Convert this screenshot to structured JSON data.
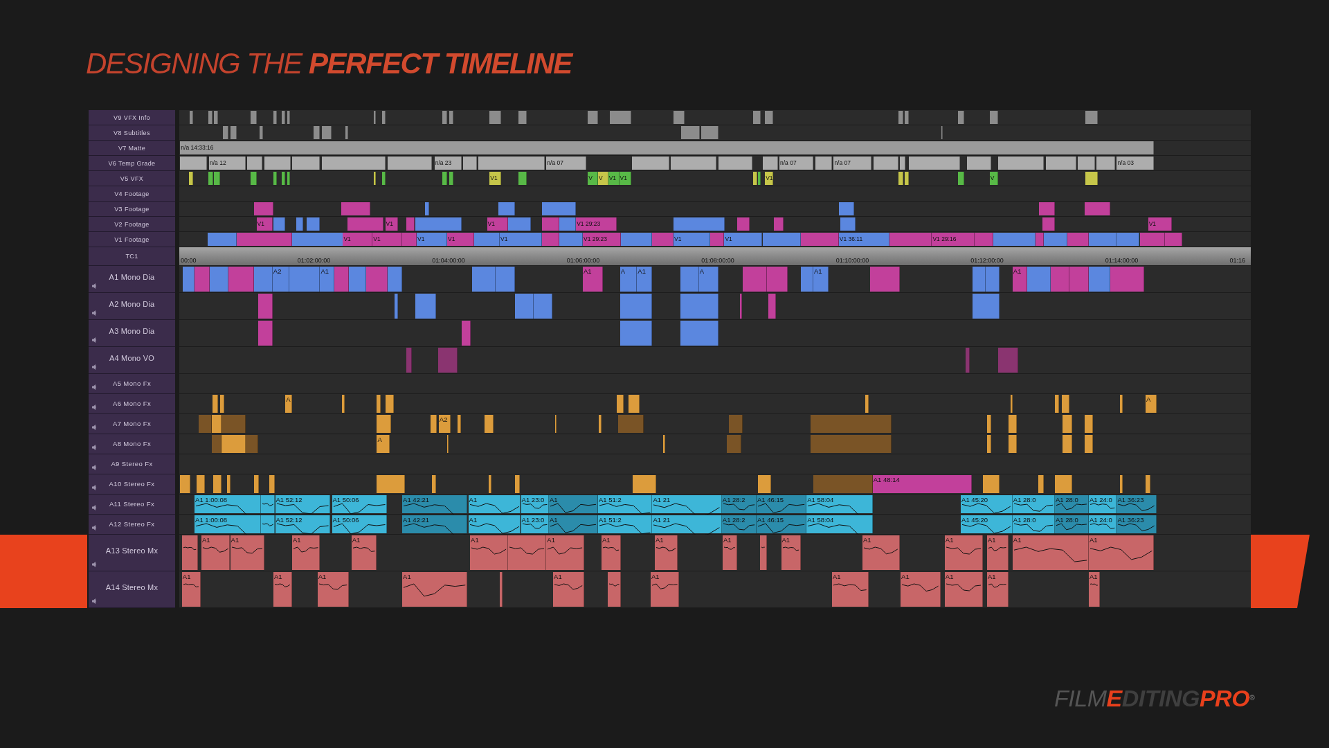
{
  "title": "DESIGNING THE **PERFECT TIMELINE**",
  "tracks": [
    {
      "name": "V9 VFX Info",
      "kind": "video",
      "clips": [
        {
          "color": "#8c8c8c"
        },
        {
          "color": "#8c8c8c"
        },
        {
          "color": "#8c8c8c"
        },
        {
          "color": "#8c8c8c"
        },
        {
          "color": "#8c8c8c"
        },
        {
          "color": "#8c8c8c"
        },
        {
          "color": "#8c8c8c"
        },
        {
          "color": "#8c8c8c"
        },
        {
          "color": "#8c8c8c"
        },
        {
          "color": "#8c8c8c"
        },
        {
          "color": "#8c8c8c"
        },
        {
          "color": "#8c8c8c"
        },
        {
          "color": "#8c8c8c"
        },
        {
          "color": "#8c8c8c"
        },
        {
          "color": "#8c8c8c"
        },
        {
          "color": "#8c8c8c"
        },
        {
          "color": "#8c8c8c"
        },
        {
          "color": "#8c8c8c"
        },
        {
          "color": "#8c8c8c"
        },
        {
          "color": "#8c8c8c"
        },
        {
          "color": "#8c8c8c"
        },
        {
          "color": "#8c8c8c"
        },
        {
          "color": "#8c8c8c"
        }
      ]
    },
    {
      "name": "V8 Subtitles",
      "kind": "video",
      "clips": [
        {
          "color": "#8c8c8c"
        },
        {
          "color": "#8c8c8c"
        },
        {
          "color": "#8c8c8c"
        },
        {
          "color": "#8c8c8c"
        },
        {
          "color": "#8c8c8c"
        },
        {
          "color": "#8c8c8c"
        },
        {
          "color": "#8c8c8c"
        },
        {
          "color": "#8c8c8c"
        },
        {
          "color": "#8c8c8c"
        }
      ]
    },
    {
      "name": "V7 Matte",
      "kind": "video",
      "clips": [
        {
          "color": "#9b9b9b",
          "label": "n/a 14:33:16"
        }
      ]
    },
    {
      "name": "V6 Temp Grade",
      "kind": "video",
      "clips": [
        {
          "color": "#adadad"
        },
        {
          "color": "#adadad",
          "label": "n/a 12"
        },
        {
          "color": "#adadad"
        },
        {
          "color": "#adadad"
        },
        {
          "color": "#adadad"
        },
        {
          "color": "#adadad"
        },
        {
          "color": "#adadad"
        },
        {
          "color": "#adadad",
          "label": "n/a 23"
        },
        {
          "color": "#adadad"
        },
        {
          "color": "#adadad"
        },
        {
          "color": "#adadad",
          "label": "n/a 07"
        },
        {
          "color": "#adadad"
        },
        {
          "color": "#adadad"
        },
        {
          "color": "#adadad"
        },
        {
          "color": "#adadad"
        },
        {
          "color": "#adadad",
          "label": "n/a 07"
        },
        {
          "color": "#adadad"
        },
        {
          "color": "#adadad",
          "label": "n/a 07"
        },
        {
          "color": "#adadad"
        },
        {
          "color": "#adadad"
        },
        {
          "color": "#adadad"
        },
        {
          "color": "#adadad"
        },
        {
          "color": "#adadad"
        },
        {
          "color": "#adadad"
        },
        {
          "color": "#adadad"
        },
        {
          "color": "#adadad"
        },
        {
          "color": "#adadad",
          "label": "n/a 03"
        }
      ]
    },
    {
      "name": "V5 VFX",
      "kind": "video",
      "clips": [
        {
          "color": "#c6c64a"
        },
        {
          "color": "#58b947"
        },
        {
          "color": "#58b947"
        },
        {
          "color": "#58b947"
        },
        {
          "color": "#58b947"
        },
        {
          "color": "#58b947"
        },
        {
          "color": "#58b947"
        },
        {
          "color": "#c6c64a"
        },
        {
          "color": "#58b947"
        },
        {
          "color": "#58b947"
        },
        {
          "color": "#58b947"
        },
        {
          "color": "#c6c64a",
          "label": "V1"
        },
        {
          "color": "#58b947"
        },
        {
          "color": "#58b947",
          "label": "V"
        },
        {
          "color": "#c6c64a",
          "label": "V"
        },
        {
          "color": "#58b947",
          "label": "V1"
        },
        {
          "color": "#58b947",
          "label": "V1"
        },
        {
          "color": "#c6c64a"
        },
        {
          "color": "#58b947"
        },
        {
          "color": "#c6c64a",
          "label": "V1"
        },
        {
          "color": "#c6c64a"
        },
        {
          "color": "#c6c64a"
        },
        {
          "color": "#58b947"
        },
        {
          "color": "#58b947",
          "label": "V"
        },
        {
          "color": "#c6c64a"
        }
      ]
    },
    {
      "name": "V4 Footage",
      "kind": "video"
    },
    {
      "name": "V3 Footage",
      "kind": "video",
      "clips": [
        {
          "color": "#c2409b"
        },
        {
          "color": "#c2409b"
        },
        {
          "color": "#5b87df"
        },
        {
          "color": "#5b87df"
        },
        {
          "color": "#5b87df"
        },
        {
          "color": "#5b87df"
        },
        {
          "color": "#c2409b"
        },
        {
          "color": "#c2409b"
        }
      ]
    },
    {
      "name": "V2 Footage",
      "kind": "video",
      "clips": [
        {
          "color": "#c2409b",
          "label": "V1"
        },
        {
          "color": "#5b87df"
        },
        {
          "color": "#5b87df"
        },
        {
          "color": "#5b87df"
        },
        {
          "color": "#c2409b"
        },
        {
          "color": "#c2409b",
          "label": "V1"
        },
        {
          "color": "#c2409b"
        },
        {
          "color": "#5b87df"
        },
        {
          "color": "#c2409b",
          "label": "V1"
        },
        {
          "color": "#5b87df"
        },
        {
          "color": "#c2409b"
        },
        {
          "color": "#5b87df"
        },
        {
          "color": "#c2409b",
          "label": "V1 29:23"
        },
        {
          "color": "#5b87df"
        },
        {
          "color": "#c2409b"
        },
        {
          "color": "#c2409b"
        },
        {
          "color": "#5b87df"
        },
        {
          "color": "#c2409b"
        },
        {
          "color": "#c2409b",
          "label": "V1"
        }
      ]
    },
    {
      "name": "V1 Footage",
      "kind": "video",
      "clips": [
        {
          "color": "#5b87df"
        },
        {
          "color": "#c2409b"
        },
        {
          "color": "#5b87df"
        },
        {
          "color": "#c2409b",
          "label": "V1"
        },
        {
          "color": "#c2409b",
          "label": "V1"
        },
        {
          "color": "#c2409b"
        },
        {
          "color": "#5b87df",
          "label": "V1"
        },
        {
          "color": "#c2409b",
          "label": "V1"
        },
        {
          "color": "#5b87df"
        },
        {
          "color": "#5b87df",
          "label": "V1"
        },
        {
          "color": "#c2409b"
        },
        {
          "color": "#5b87df"
        },
        {
          "color": "#c2409b",
          "label": "V1 29:23"
        },
        {
          "color": "#5b87df"
        },
        {
          "color": "#c2409b"
        },
        {
          "color": "#5b87df",
          "label": "V1"
        },
        {
          "color": "#c2409b"
        },
        {
          "color": "#5b87df",
          "label": "V1"
        },
        {
          "color": "#5b87df"
        },
        {
          "color": "#c2409b"
        },
        {
          "color": "#5b87df",
          "label": "V1 36:11"
        },
        {
          "color": "#c2409b"
        },
        {
          "color": "#c2409b",
          "label": "V1 29:16"
        },
        {
          "color": "#c2409b"
        },
        {
          "color": "#5b87df"
        },
        {
          "color": "#c2409b"
        },
        {
          "color": "#5b87df"
        },
        {
          "color": "#c2409b"
        },
        {
          "color": "#5b87df"
        },
        {
          "color": "#5b87df"
        },
        {
          "color": "#c2409b"
        },
        {
          "color": "#c2409b"
        }
      ]
    },
    {
      "name": "TC1",
      "kind": "timecode",
      "marks": [
        "00:00",
        "01:02:00:00",
        "01:04:00:00",
        "01:06:00:00",
        "01:08:00:00",
        "01:10:00:00",
        "01:12:00:00",
        "01:14:00:00",
        "01:16"
      ]
    },
    {
      "name": "A1 Mono Dia",
      "kind": "audio",
      "volume_lines": false,
      "clips": [
        {
          "color": "#5b87df"
        },
        {
          "color": "#c2409b"
        },
        {
          "color": "#5b87df"
        },
        {
          "color": "#c2409b"
        },
        {
          "color": "#5b87df"
        },
        {
          "color": "#5b87df",
          "label": "A2"
        },
        {
          "color": "#5b87df"
        },
        {
          "color": "#5b87df",
          "label": "A1"
        },
        {
          "color": "#c2409b"
        },
        {
          "color": "#5b87df"
        },
        {
          "color": "#c2409b"
        },
        {
          "color": "#5b87df"
        },
        {
          "color": "#5b87df"
        },
        {
          "color": "#5b87df"
        },
        {
          "color": "#c2409b",
          "label": "A1"
        },
        {
          "color": "#5b87df",
          "label": "A"
        },
        {
          "color": "#5b87df",
          "label": "A1"
        },
        {
          "color": "#5b87df"
        },
        {
          "color": "#5b87df",
          "label": "A"
        },
        {
          "color": "#c2409b"
        },
        {
          "color": "#c2409b"
        },
        {
          "color": "#5b87df"
        },
        {
          "color": "#5b87df",
          "label": "A1"
        },
        {
          "color": "#c2409b"
        },
        {
          "color": "#5b87df"
        },
        {
          "color": "#5b87df"
        },
        {
          "color": "#c2409b",
          "label": "A1"
        },
        {
          "color": "#5b87df"
        },
        {
          "color": "#c2409b"
        },
        {
          "color": "#c2409b"
        },
        {
          "color": "#5b87df"
        },
        {
          "color": "#c2409b"
        }
      ]
    },
    {
      "name": "A2 Mono Dia",
      "kind": "audio",
      "volume_lines": false,
      "clips": [
        {
          "color": "#c2409b"
        },
        {
          "color": "#5b87df"
        },
        {
          "color": "#5b87df"
        },
        {
          "color": "#5b87df"
        },
        {
          "color": "#5b87df"
        },
        {
          "color": "#5b87df"
        },
        {
          "color": "#5b87df"
        },
        {
          "color": "#c2409b"
        },
        {
          "color": "#c2409b"
        },
        {
          "color": "#5b87df"
        }
      ]
    },
    {
      "name": "A3 Mono Dia",
      "kind": "audio",
      "volume_lines": false,
      "clips": [
        {
          "color": "#c2409b"
        },
        {
          "color": "#c2409b"
        },
        {
          "color": "#5b87df"
        },
        {
          "color": "#5b87df"
        }
      ]
    },
    {
      "name": "A4 Mono VO",
      "kind": "audio",
      "volume_lines": false,
      "clips": [
        {
          "color": "#8a3470"
        },
        {
          "color": "#8a3470"
        },
        {
          "color": "#8a3470"
        },
        {
          "color": "#8a3470"
        }
      ]
    },
    {
      "name": "A5 Mono Fx",
      "kind": "audio"
    },
    {
      "name": "A6 Mono Fx",
      "kind": "audio",
      "volume_lines": false,
      "clips": [
        {
          "color": "#dc9c3c"
        },
        {
          "color": "#dc9c3c"
        },
        {
          "color": "#dc9c3c",
          "label": "A"
        },
        {
          "color": "#dc9c3c"
        },
        {
          "color": "#dc9c3c"
        },
        {
          "color": "#dc9c3c"
        },
        {
          "color": "#dc9c3c"
        },
        {
          "color": "#dc9c3c"
        },
        {
          "color": "#dc9c3c"
        },
        {
          "color": "#dc9c3c"
        },
        {
          "color": "#dc9c3c"
        },
        {
          "color": "#dc9c3c"
        },
        {
          "color": "#dc9c3c"
        },
        {
          "color": "#dc9c3c",
          "label": "A"
        }
      ]
    },
    {
      "name": "A7 Mono Fx",
      "kind": "audio",
      "volume_lines": false,
      "clips": [
        {
          "color": "#7a5426"
        },
        {
          "color": "#dc9c3c"
        },
        {
          "color": "#7a5426"
        },
        {
          "color": "#dc9c3c"
        },
        {
          "color": "#dc9c3c"
        },
        {
          "color": "#dc9c3c",
          "label": "A2"
        },
        {
          "color": "#dc9c3c"
        },
        {
          "color": "#dc9c3c"
        },
        {
          "color": "#dc9c3c"
        },
        {
          "color": "#dc9c3c"
        },
        {
          "color": "#7a5426"
        },
        {
          "color": "#7a5426"
        },
        {
          "color": "#7a5426"
        },
        {
          "color": "#dc9c3c"
        },
        {
          "color": "#dc9c3c"
        },
        {
          "color": "#dc9c3c"
        },
        {
          "color": "#dc9c3c"
        }
      ]
    },
    {
      "name": "A8 Mono Fx",
      "kind": "audio",
      "volume_lines": false,
      "clips": [
        {
          "color": "#7a5426"
        },
        {
          "color": "#dc9c3c"
        },
        {
          "color": "#7a5426"
        },
        {
          "color": "#dc9c3c",
          "label": "A"
        },
        {
          "color": "#dc9c3c"
        },
        {
          "color": "#dc9c3c"
        },
        {
          "color": "#7a5426"
        },
        {
          "color": "#7a5426"
        },
        {
          "color": "#dc9c3c"
        },
        {
          "color": "#dc9c3c"
        },
        {
          "color": "#dc9c3c"
        },
        {
          "color": "#dc9c3c"
        }
      ]
    },
    {
      "name": "A9 Stereo Fx",
      "kind": "audio"
    },
    {
      "name": "A10 Stereo Fx",
      "kind": "audio",
      "volume_lines": false,
      "clips": [
        {
          "color": "#dc9c3c"
        },
        {
          "color": "#dc9c3c"
        },
        {
          "color": "#dc9c3c"
        },
        {
          "color": "#dc9c3c"
        },
        {
          "color": "#dc9c3c"
        },
        {
          "color": "#dc9c3c"
        },
        {
          "color": "#dc9c3c"
        },
        {
          "color": "#dc9c3c"
        },
        {
          "color": "#dc9c3c"
        },
        {
          "color": "#dc9c3c"
        },
        {
          "color": "#dc9c3c"
        },
        {
          "color": "#dc9c3c"
        },
        {
          "color": "#7a5426"
        },
        {
          "color": "#c2409b",
          "label": "A1 48:14"
        },
        {
          "color": "#dc9c3c"
        },
        {
          "color": "#dc9c3c"
        },
        {
          "color": "#dc9c3c"
        },
        {
          "color": "#dc9c3c"
        },
        {
          "color": "#dc9c3c"
        }
      ]
    },
    {
      "name": "A11 Stereo Fx",
      "kind": "audio",
      "volume_lines": true,
      "clips": [
        {
          "color": "#3db6d8",
          "label": "A1 1:00:08"
        },
        {
          "color": "#3db6d8"
        },
        {
          "color": "#3db6d8",
          "label": "A1 52:12"
        },
        {
          "color": "#3db6d8",
          "label": "A1 50:06"
        },
        {
          "color": "#2b8cab",
          "label": "A1 42:21"
        },
        {
          "color": "#3db6d8",
          "label": "A1"
        },
        {
          "color": "#3db6d8",
          "label": "A1 23:0"
        },
        {
          "color": "#2b8cab",
          "label": "A1"
        },
        {
          "color": "#3db6d8",
          "label": "A1 51:2"
        },
        {
          "color": "#3db6d8",
          "label": "A1 21"
        },
        {
          "color": "#2b8cab",
          "label": "A1 28:2"
        },
        {
          "color": "#2b8cab",
          "label": "A1 46:15"
        },
        {
          "color": "#3db6d8",
          "label": "A1 58:04"
        },
        {
          "color": "#3db6d8",
          "label": "A1 45:20"
        },
        {
          "color": "#3db6d8",
          "label": "A1 28:0"
        },
        {
          "color": "#2b8cab",
          "label": "A1 28:0"
        },
        {
          "color": "#3db6d8",
          "label": "A1 24:0"
        },
        {
          "color": "#2b8cab",
          "label": "A1 36:23"
        }
      ]
    },
    {
      "name": "A12 Stereo Fx",
      "kind": "audio",
      "volume_lines": true,
      "clips": [
        {
          "color": "#3db6d8",
          "label": "A1 1:00:08"
        },
        {
          "color": "#3db6d8"
        },
        {
          "color": "#3db6d8",
          "label": "A1 52:12"
        },
        {
          "color": "#3db6d8",
          "label": "A1 50:06"
        },
        {
          "color": "#2b8cab",
          "label": "A1 42:21"
        },
        {
          "color": "#3db6d8",
          "label": "A1"
        },
        {
          "color": "#3db6d8",
          "label": "A1 23:0"
        },
        {
          "color": "#2b8cab",
          "label": "A1"
        },
        {
          "color": "#3db6d8",
          "label": "A1 51:2"
        },
        {
          "color": "#3db6d8",
          "label": "A1 21"
        },
        {
          "color": "#2b8cab",
          "label": "A1 28:2"
        },
        {
          "color": "#2b8cab",
          "label": "A1 46:15"
        },
        {
          "color": "#3db6d8",
          "label": "A1 58:04"
        },
        {
          "color": "#3db6d8",
          "label": "A1 45:20"
        },
        {
          "color": "#3db6d8",
          "label": "A1 28:0"
        },
        {
          "color": "#2b8cab",
          "label": "A1 28:0"
        },
        {
          "color": "#3db6d8",
          "label": "A1 24:0"
        },
        {
          "color": "#2b8cab",
          "label": "A1 36:23"
        }
      ]
    },
    {
      "name": "A13 Stereo Mx",
      "kind": "audio",
      "volume_lines": true,
      "clips": [
        {
          "color": "#c86668"
        },
        {
          "color": "#c86668",
          "label": "A1"
        },
        {
          "color": "#c86668",
          "label": "A1"
        },
        {
          "color": "#c86668",
          "label": "A1"
        },
        {
          "color": "#c86668",
          "label": "A1"
        },
        {
          "color": "#c86668",
          "label": "A1"
        },
        {
          "color": "#c86668"
        },
        {
          "color": "#c86668",
          "label": "A1"
        },
        {
          "color": "#c86668",
          "label": "A1"
        },
        {
          "color": "#c86668",
          "label": "A1"
        },
        {
          "color": "#c86668",
          "label": "A1"
        },
        {
          "color": "#c86668"
        },
        {
          "color": "#c86668",
          "label": "A1"
        },
        {
          "color": "#c86668",
          "label": "A1"
        },
        {
          "color": "#c86668",
          "label": "A1"
        },
        {
          "color": "#c86668",
          "label": "A1"
        },
        {
          "color": "#c86668",
          "label": "A1"
        },
        {
          "color": "#c86668",
          "label": "A1"
        }
      ]
    },
    {
      "name": "A14 Stereo Mx",
      "kind": "audio",
      "volume_lines": true,
      "clips": [
        {
          "color": "#c86668",
          "label": "A1"
        },
        {
          "color": "#c86668",
          "label": "A1"
        },
        {
          "color": "#c86668",
          "label": "A1"
        },
        {
          "color": "#c86668",
          "label": "A1"
        },
        {
          "color": "#c86668"
        },
        {
          "color": "#c86668",
          "label": "A1"
        },
        {
          "color": "#c86668"
        },
        {
          "color": "#c86668",
          "label": "A1"
        },
        {
          "color": "#c86668",
          "label": "A1"
        },
        {
          "color": "#c86668",
          "label": "A1"
        },
        {
          "color": "#c86668",
          "label": "A1"
        },
        {
          "color": "#c86668",
          "label": "A1"
        },
        {
          "color": "#c86668",
          "label": "A1"
        }
      ]
    }
  ],
  "brand": {
    "segments": [
      {
        "text": "FILM",
        "kind": "thin"
      },
      {
        "text": "E",
        "kind": "striped"
      },
      {
        "text": "DITING",
        "kind": "bold"
      },
      {
        "text": "PRO",
        "kind": "accent"
      },
      {
        "text": "®",
        "kind": "mark"
      }
    ]
  }
}
